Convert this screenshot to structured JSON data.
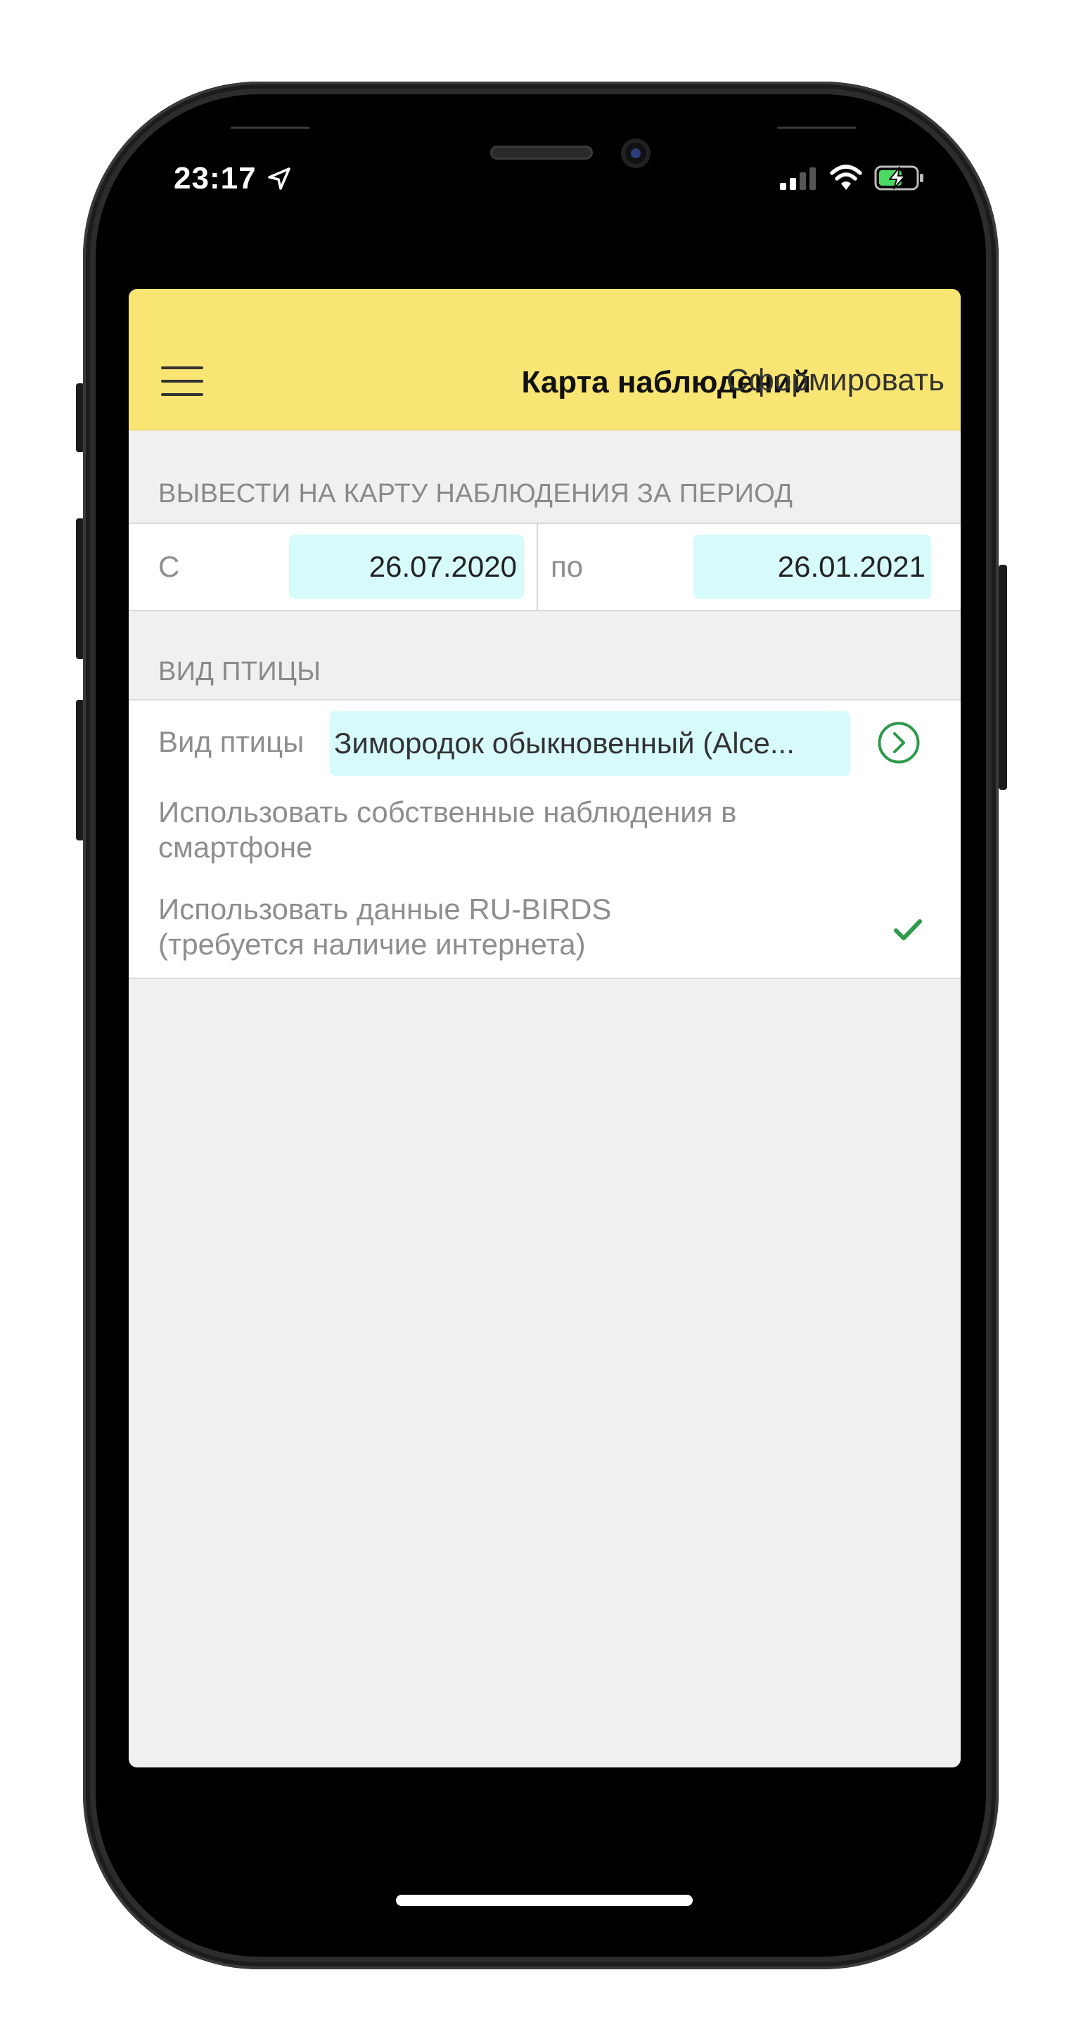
{
  "status_bar": {
    "time": "23:17",
    "icons": [
      "location-arrow-icon",
      "cellular-signal-icon",
      "wifi-icon",
      "battery-charging-icon"
    ]
  },
  "header": {
    "title": "Карта наблюдений",
    "action": "Сформировать",
    "menu_icon": "hamburger-menu-icon"
  },
  "period_section": {
    "title": "ВЫВЕСТИ НА КАРТУ НАБЛЮДЕНИЯ ЗА ПЕРИОД",
    "from_label": "С",
    "from_value": "26.07.2020",
    "to_label": "по",
    "to_value": "26.01.2021"
  },
  "bird_section": {
    "title": "ВИД ПТИЦЫ",
    "species_label": "Вид птицы",
    "species_value": "Зимородок обыкновенный (Alce...",
    "own_observations_line1": "Использовать собственные наблюдения в",
    "own_observations_line2": "смартфоне",
    "own_observations_checked": false,
    "rubirds_line1": "Использовать данные RU-BIRDS",
    "rubirds_line2": "(требуется наличие интернета)",
    "rubirds_checked": true
  },
  "colors": {
    "header_bg": "#f8e573",
    "field_bg": "#d7fafa",
    "accent_green": "#2e9a4a",
    "page_bg": "#f0f0f0"
  }
}
